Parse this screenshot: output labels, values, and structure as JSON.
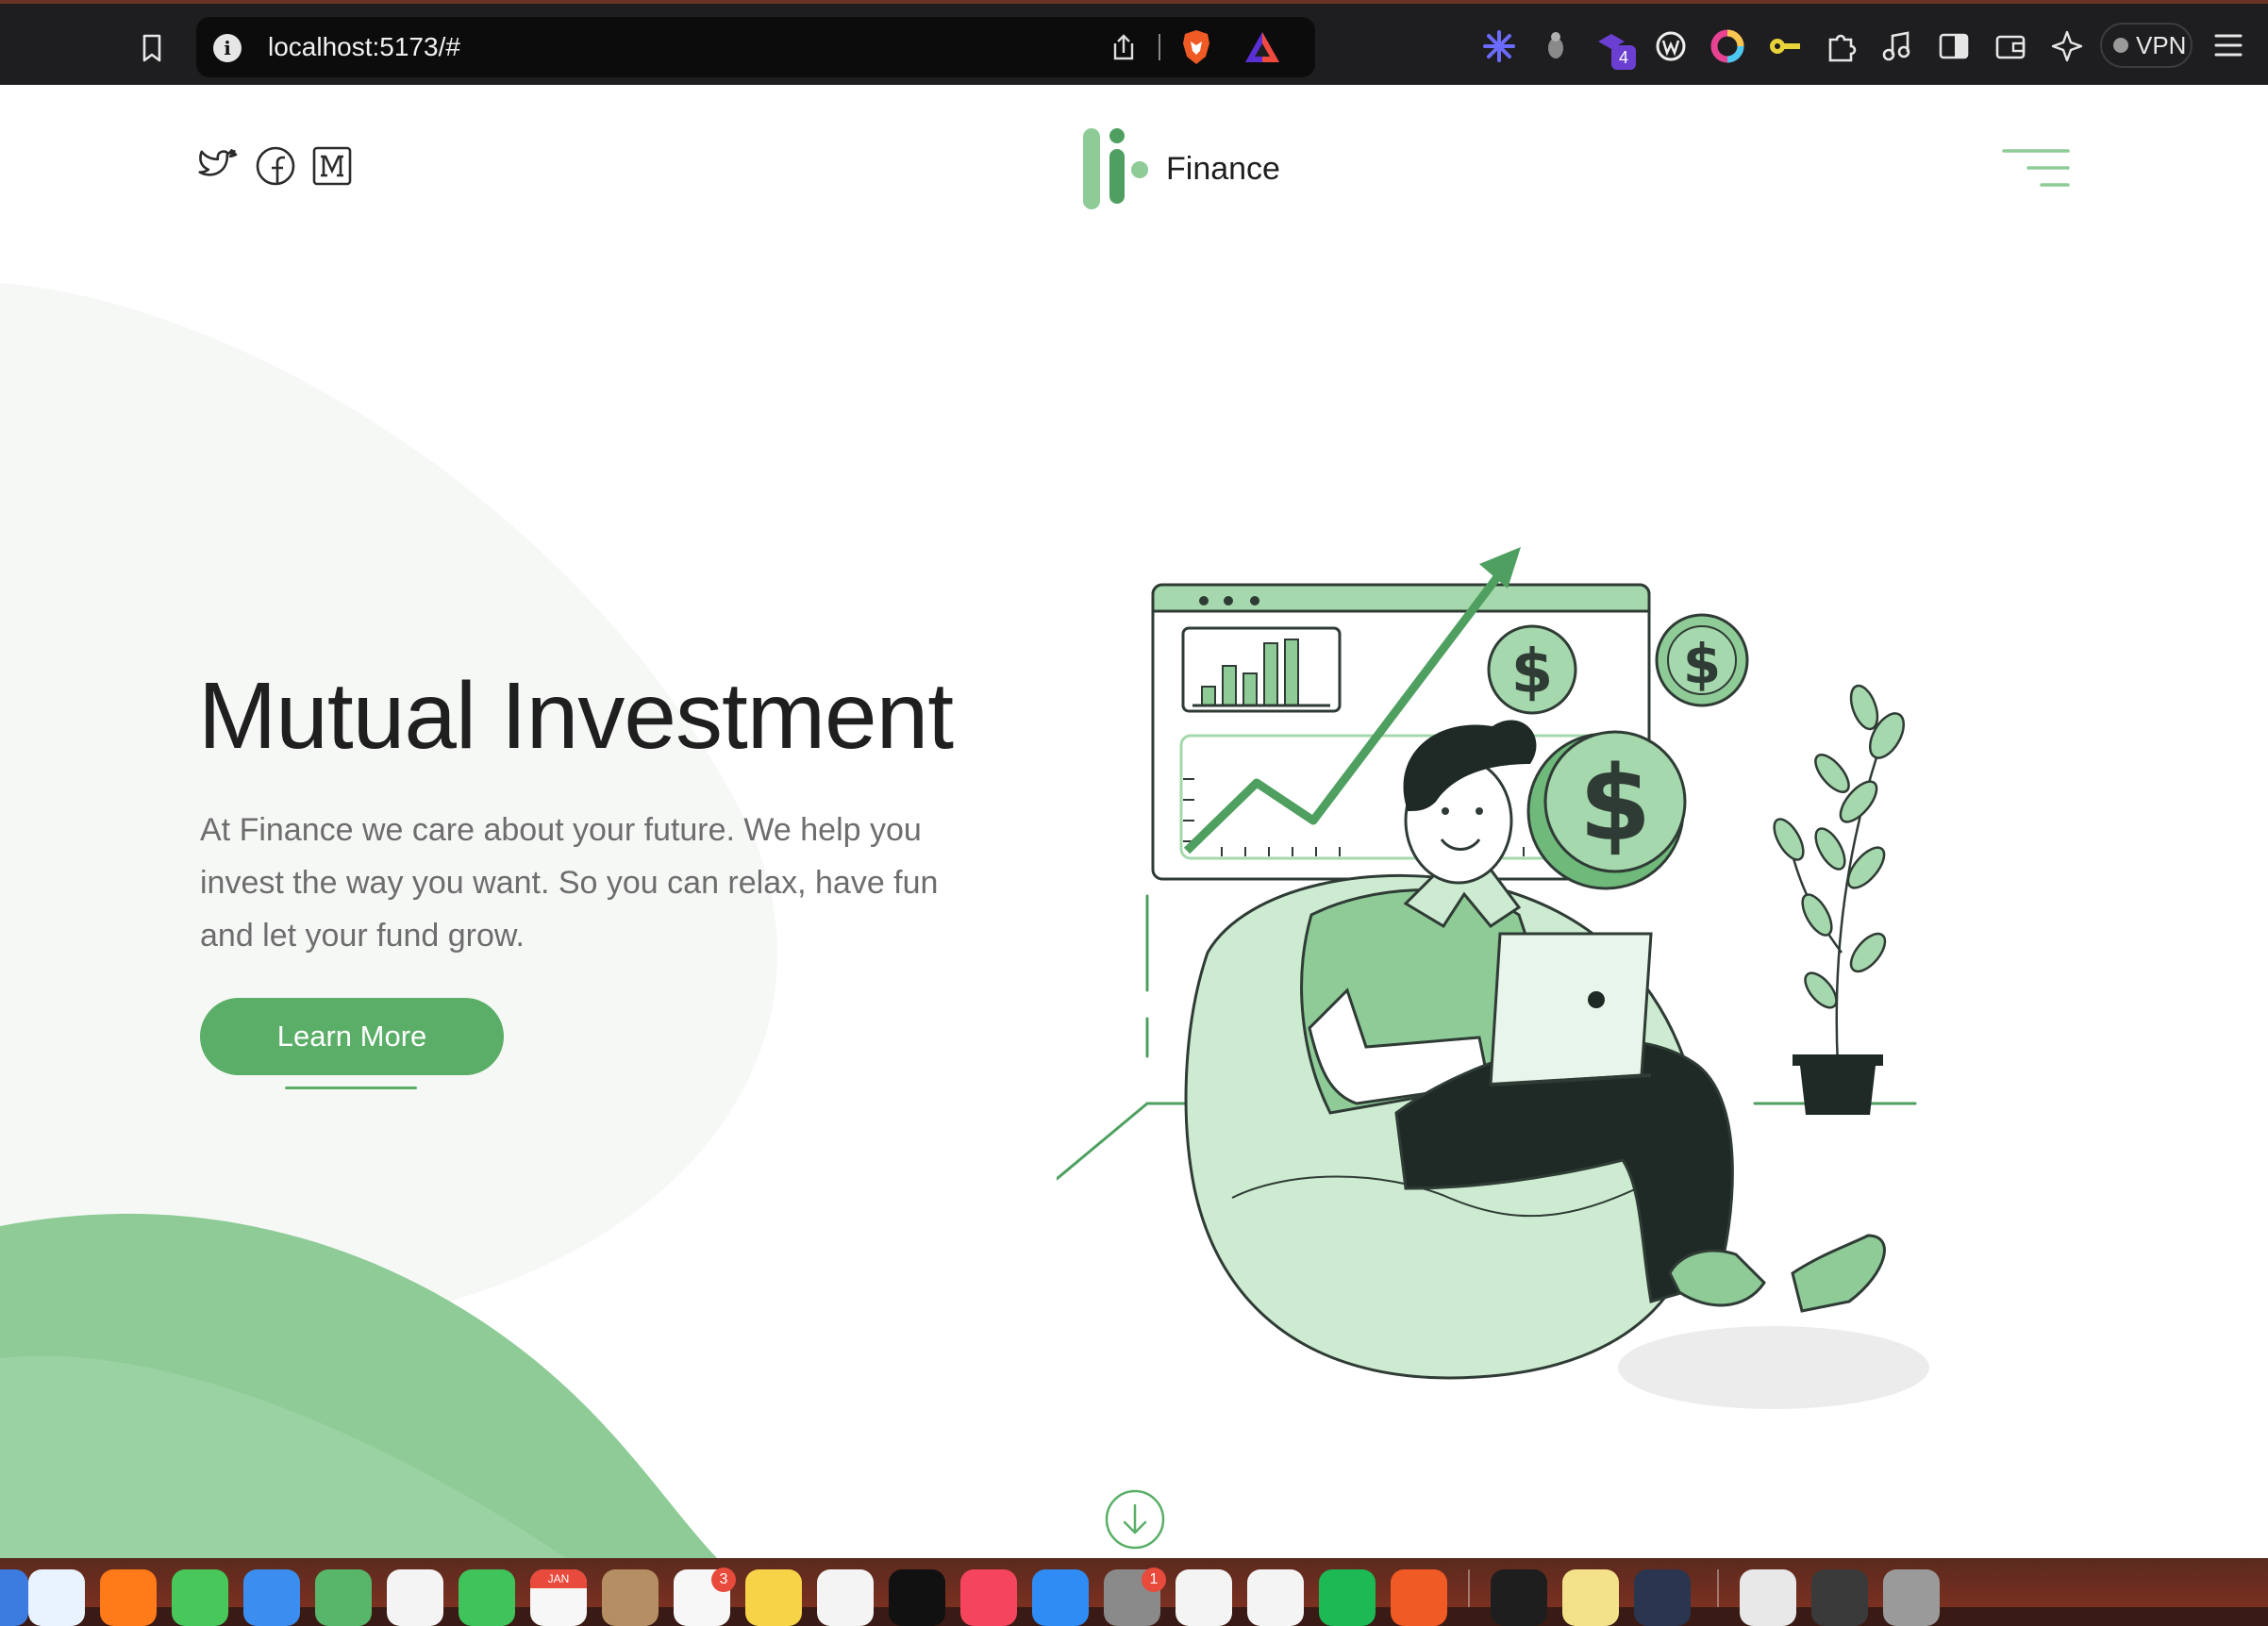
{
  "browser": {
    "url": "localhost:5173/#",
    "vpn_label": "VPN",
    "extension_badge": "4",
    "extensions": [
      "asterisk-icon",
      "bug-icon",
      "puzzle-badge-icon",
      "w-icon",
      "color-wheel-icon",
      "key-icon",
      "extensions-icon",
      "music-note-icon",
      "sidebar-icon",
      "wallet-icon",
      "sparkle-icon"
    ]
  },
  "header": {
    "brand": "Finance",
    "social": [
      "twitter-icon",
      "facebook-icon",
      "medium-icon"
    ]
  },
  "hero": {
    "title": "Mutual Investment",
    "text": "At Finance we care about your future. We help you invest the way you want. So you can relax, have fun and let your fund grow.",
    "cta": "Learn More"
  },
  "dock": {
    "calendar_month": "JAN",
    "reminders_badge": "3",
    "settings_badge": "1"
  },
  "colors": {
    "accent": "#5aae67",
    "accent_light": "#a6d8ad",
    "ink": "#1f1f1f",
    "body_text": "#6d6d6d"
  }
}
